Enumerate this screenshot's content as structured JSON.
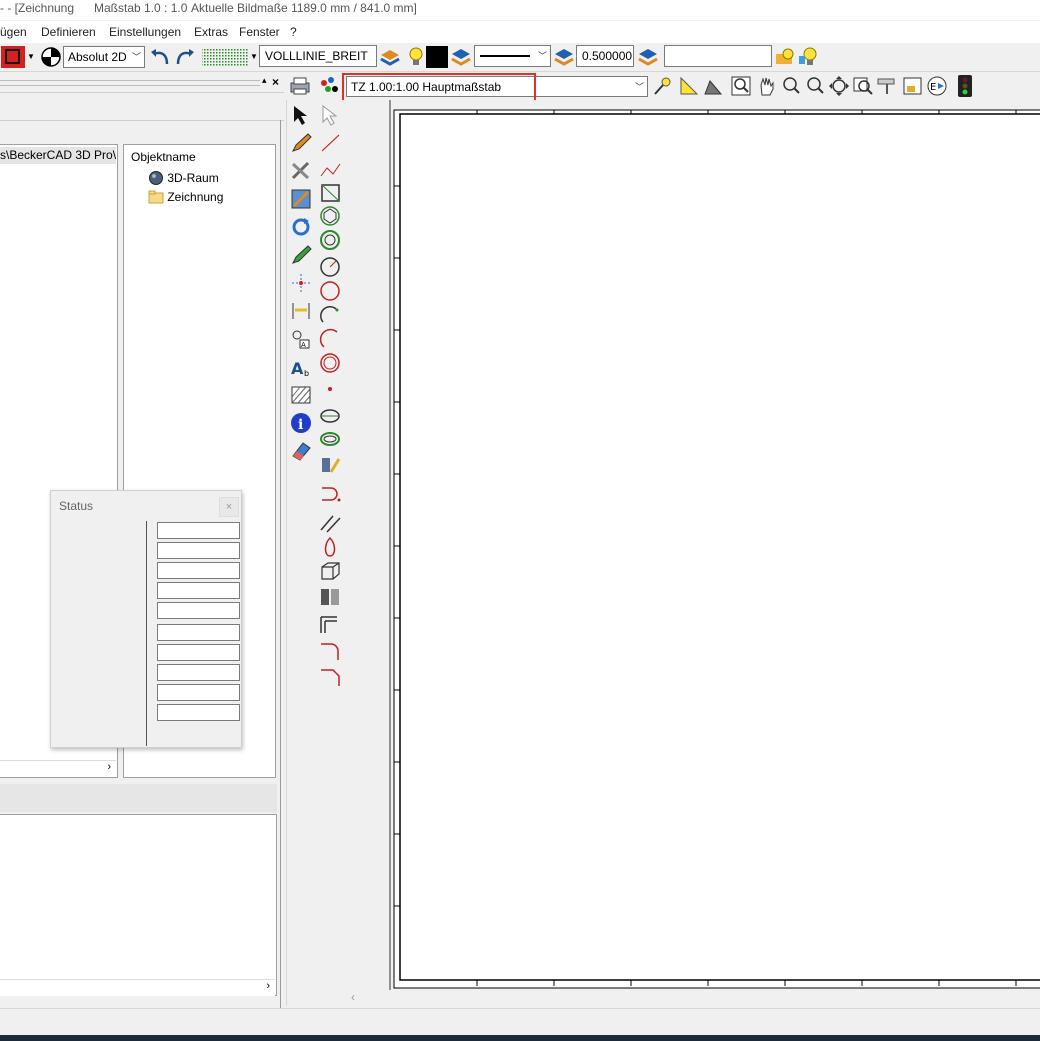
{
  "window": {
    "title_prefix": "- - [Zeichnung",
    "title_scale": "Maßstab 1.0 : 1.0",
    "title_dims": "Aktuelle Bildmaße 1189.0 mm / 841.0 mm]"
  },
  "menu": {
    "items": [
      "ügen",
      "Definieren",
      "Einstellungen",
      "Extras",
      "Fenster",
      "?"
    ]
  },
  "toolbar": {
    "coord_mode": "Absolut 2D",
    "line_type": "VOLLLINIE_BREIT",
    "line_width": "0.500000",
    "empty_field": "",
    "scale_combo": "TZ 1.00:1.00 Hauptmaßstab"
  },
  "colors": {
    "highlight": "#e0302a",
    "layer_orange": "#e08a1e",
    "layer_blue": "#1f5fb4"
  },
  "explorer": {
    "path_text": "s\\BeckerCAD 3D Pro\\",
    "object_header": "Objektname",
    "objects": [
      {
        "label": "3D-Raum",
        "icon": "sphere-icon"
      },
      {
        "label": "Zeichnung",
        "icon": "folder-icon"
      }
    ]
  },
  "status_panel": {
    "title": "Status",
    "close_label": "×"
  },
  "panel_controls": {
    "pin": "▴",
    "close": "×"
  }
}
